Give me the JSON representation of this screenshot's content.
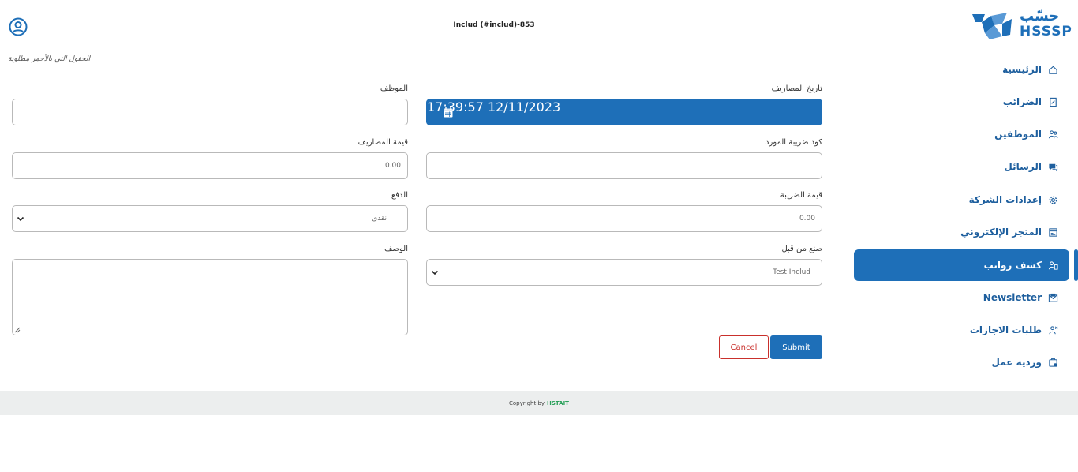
{
  "header": {
    "title": "Includ (#includ)-853",
    "required_note": "الحقول التي بالأحمر مطلوبة"
  },
  "logo": {
    "text_ar": "حسّب",
    "text_en": "HSSSP"
  },
  "sidebar": {
    "items": [
      {
        "label": "الرئيسية",
        "icon": "home-icon"
      },
      {
        "label": "الضرائب",
        "icon": "tax-document-icon"
      },
      {
        "label": "الموظفين",
        "icon": "users-icon"
      },
      {
        "label": "الرسائل",
        "icon": "chat-icon"
      },
      {
        "label": "إعدادات الشركة",
        "icon": "gear-icon"
      },
      {
        "label": "المتجر الإلكتروني",
        "icon": "store-icon"
      },
      {
        "label": "كشف رواتب",
        "icon": "payroll-icon",
        "active": true
      },
      {
        "label": "Newsletter",
        "icon": "newsletter-icon"
      },
      {
        "label": "طلبات الاجازات",
        "icon": "leave-request-icon"
      },
      {
        "label": "وردية عمل",
        "icon": "shift-icon"
      }
    ]
  },
  "form": {
    "expense_date": {
      "label": "تاريخ المصاريف",
      "value": "17:39:57 12/11/2023"
    },
    "employee": {
      "label": "الموظف",
      "value": ""
    },
    "supplier_tax_code": {
      "label": "كود ضريبة المورد",
      "value": ""
    },
    "expense_value": {
      "label": "قيمة المصاريف",
      "value": "0.00"
    },
    "tax_value": {
      "label": "قيمة الضريبة",
      "value": "0.00"
    },
    "payment": {
      "label": "الدفع",
      "value": "نقدى"
    },
    "created_by": {
      "label": "صنع من قبل",
      "value": "Test Includ"
    },
    "description": {
      "label": "الوصف",
      "value": ""
    },
    "cancel_label": "Cancel",
    "submit_label": "Submit"
  },
  "footer": {
    "copyright": "Copyright by",
    "brand": "HSTAIT"
  },
  "colors": {
    "primary": "#1e6fb8",
    "danger": "#c9302c",
    "footer_brand": "#2aa15a",
    "footer_bg": "#eceeee"
  }
}
